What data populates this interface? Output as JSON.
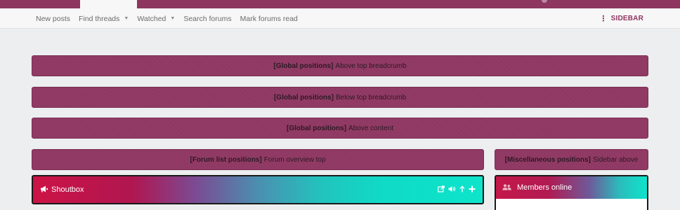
{
  "subnav": {
    "links": [
      {
        "label": "New posts",
        "has_caret": false
      },
      {
        "label": "Find threads",
        "has_caret": true
      },
      {
        "label": "Watched",
        "has_caret": true
      },
      {
        "label": "Search forums",
        "has_caret": false
      },
      {
        "label": "Mark forums read",
        "has_caret": false
      }
    ],
    "sidebar_label": "SIDEBAR"
  },
  "ads": {
    "above_breadcrumb": {
      "tag": "[Global positions]",
      "text": "Above top breadcrumb"
    },
    "below_breadcrumb": {
      "tag": "[Global positions]",
      "text": "Below top breadcrumb"
    },
    "above_content": {
      "tag": "[Global positions]",
      "text": "Above content"
    },
    "forum_overview_top": {
      "tag": "[Forum list positions]",
      "text": "Forum overview top"
    },
    "sidebar_above": {
      "tag": "[Miscellaneous positions]",
      "text": "Sidebar above"
    }
  },
  "shoutbox": {
    "title": "Shoutbox",
    "icon": "megaphone-icon",
    "tools": [
      "external-link-icon",
      "volume-icon",
      "arrow-up-icon",
      "plus-icon"
    ]
  },
  "members_online": {
    "title": "Members online",
    "icon": "users-icon"
  },
  "colors": {
    "brand": "#8e3560",
    "background": "#eceeef",
    "shoutbox_gradient_start": "#cc1346",
    "shoutbox_gradient_end": "#0ee4cb"
  }
}
